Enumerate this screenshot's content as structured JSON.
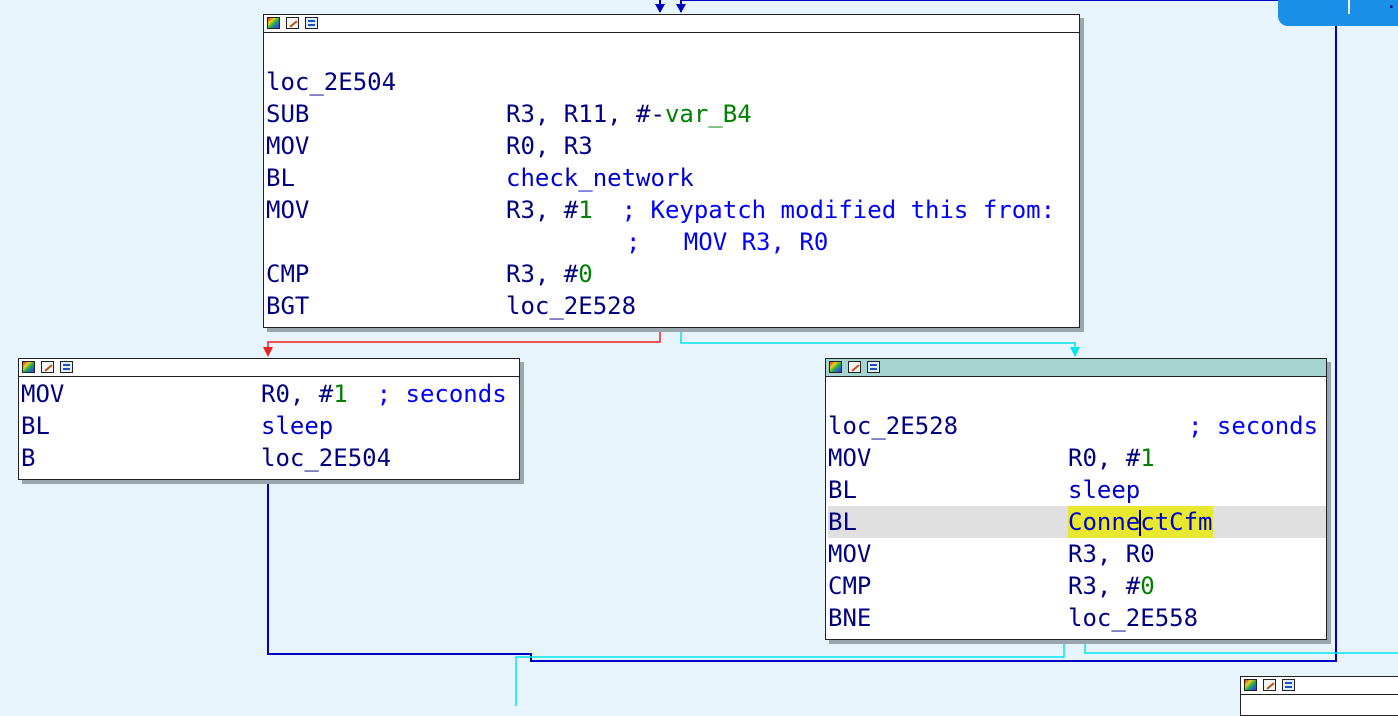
{
  "window": {
    "corner_badge_text": "",
    "corner_fragment": "."
  },
  "node_a": {
    "label": "loc_2E504",
    "rows": [
      {
        "mn": "SUB",
        "a1": "R3, R11, #-",
        "a2": "var_B4"
      },
      {
        "mn": "MOV",
        "a1": "R0, R3"
      },
      {
        "mn": "BL",
        "a1": "check_network"
      },
      {
        "mn": "MOV",
        "a1": "R3, #",
        "a2": "1",
        "c1": "  ; Keypatch modified this from:"
      },
      {
        "c2": ";   MOV R3, R0"
      },
      {
        "mn": "CMP",
        "a1": "R3, #",
        "a2": "0"
      },
      {
        "mn": "BGT",
        "a1": "loc_2E528"
      }
    ]
  },
  "node_b": {
    "rows": [
      {
        "mn": "MOV",
        "a1": "R0, #",
        "a2": "1",
        "c1": "  ; seconds"
      },
      {
        "mn": "BL",
        "a1": "sleep"
      },
      {
        "mn": "B",
        "a1": "loc_2E504"
      }
    ]
  },
  "node_c": {
    "label": "loc_2E528",
    "label_comment": "; seconds",
    "rows": [
      {
        "mn": "MOV",
        "a1": "R0, #",
        "a2": "1"
      },
      {
        "mn": "BL",
        "a1": "sleep"
      },
      {
        "mn": "BL",
        "a1a": "Conne",
        "a1b": "ctCfm"
      },
      {
        "mn": "MOV",
        "a1": "R3, R0"
      },
      {
        "mn": "CMP",
        "a1": "R3, #",
        "a2": "0"
      },
      {
        "mn": "BNE",
        "a1": "loc_2E558"
      }
    ]
  },
  "colors": {
    "canvas": "#e8f4fb",
    "edge_true": "#00e5ee",
    "edge_false": "#ee2020",
    "edge_uncond": "#0000c0",
    "selected_title": "#a6d4d1",
    "highlight": "#e8e830"
  }
}
